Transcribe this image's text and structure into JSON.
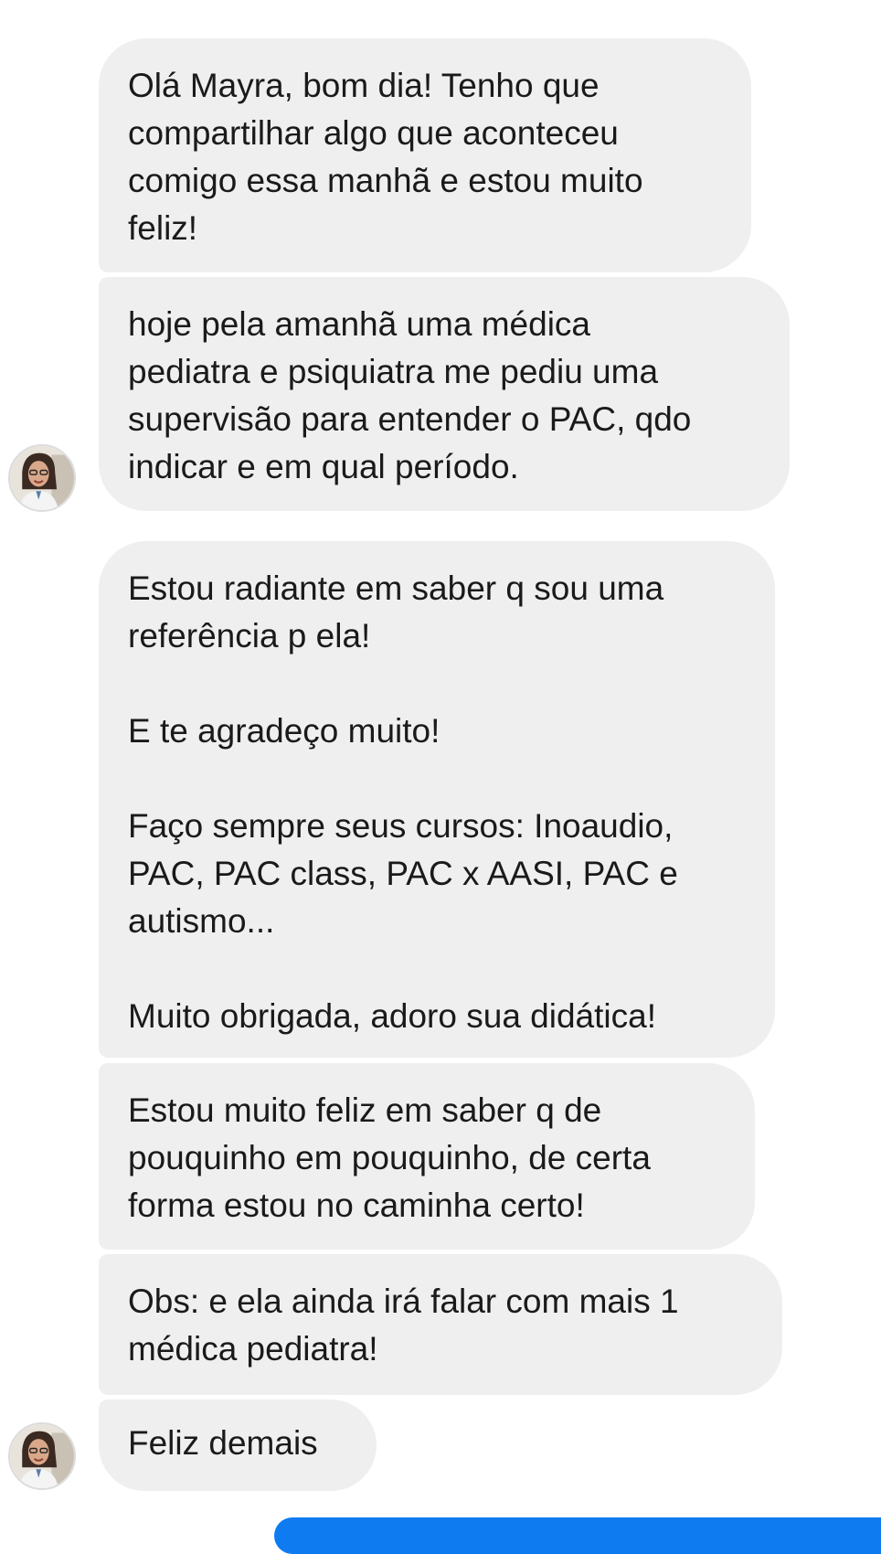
{
  "conversation": {
    "messages": [
      {
        "sender": "contact",
        "text": "Olá Mayra, bom dia! Tenho que\ncompartilhar algo que aconteceu\ncomigo essa manhã e estou muito\nfeliz!"
      },
      {
        "sender": "contact",
        "text": "hoje pela amanhã uma médica\npediatra e psiquiatra me pediu uma\nsupervisão para entender o PAC, qdo\nindicar e em qual período."
      },
      {
        "sender": "contact",
        "text": "Estou radiante em saber q sou uma\nreferência p ela!\n\nE te agradeço muito!\n\nFaço sempre seus cursos: Inoaudio,\nPAC, PAC class, PAC x AASI, PAC e\nautismo...\n\nMuito obrigada, adoro sua didática!"
      },
      {
        "sender": "contact",
        "text": "Estou muito feliz em saber q de\npouquinho em pouquinho, de certa\nforma estou no caminha certo!"
      },
      {
        "sender": "contact",
        "text": "Obs: e ela ainda irá falar com mais 1\nmédica pediatra!"
      },
      {
        "sender": "contact",
        "text": "Feliz  demais"
      }
    ]
  },
  "colors": {
    "incoming_bubble": "#efefef",
    "outgoing_bubble": "#0f7bf0",
    "background": "#ffffff"
  },
  "icons": {
    "avatar": "contact-avatar-photo"
  }
}
